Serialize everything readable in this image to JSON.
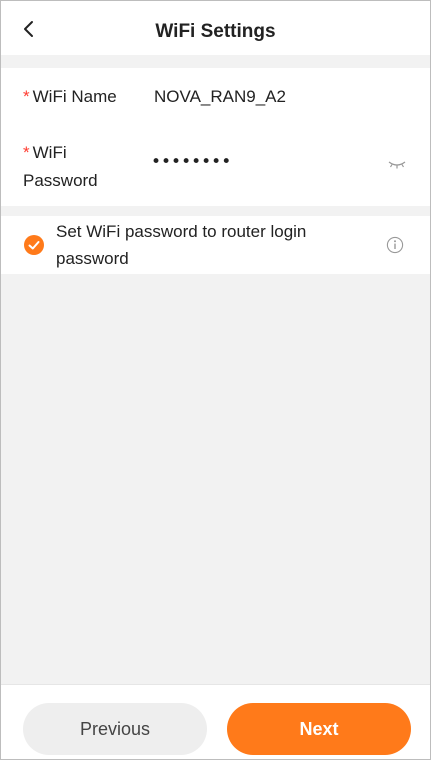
{
  "header": {
    "title": "WiFi Settings",
    "back_icon": "chevron-left-icon"
  },
  "form": {
    "required_mark": "*",
    "wifi_name_label": "WiFi Name",
    "wifi_name_value": "NOVA_RAN9_A2",
    "wifi_password_label": "WiFi Password",
    "wifi_password_value": "••••••••",
    "password_toggle_icon": "eye-closed-icon"
  },
  "option": {
    "checked": true,
    "label": "Set WiFi password to router login password",
    "info_icon": "info-icon",
    "accent_color": "#ff7a1a"
  },
  "footer": {
    "previous_label": "Previous",
    "next_label": "Next"
  },
  "colors": {
    "accent": "#ff7a1a",
    "required": "#ff3b30",
    "background": "#f2f2f2"
  }
}
